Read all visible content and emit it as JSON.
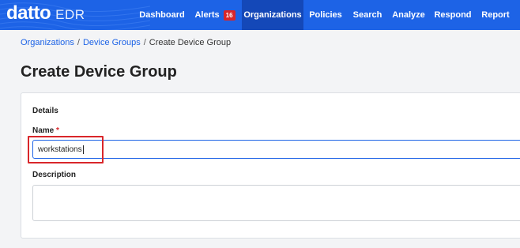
{
  "header": {
    "logo": "datto",
    "product": "EDR",
    "nav": [
      {
        "label": "Dashboard",
        "active": false
      },
      {
        "label": "Alerts",
        "badge": "16",
        "active": false
      },
      {
        "label": "Organizations",
        "active": true
      },
      {
        "label": "Policies",
        "active": false
      },
      {
        "label": "Search",
        "active": false
      },
      {
        "label": "Analyze",
        "active": false
      },
      {
        "label": "Respond",
        "active": false
      },
      {
        "label": "Report",
        "active": false
      }
    ],
    "colors": {
      "bar": "#1d63e6",
      "active": "#1448b8",
      "badge": "#d9262a"
    }
  },
  "breadcrumb": {
    "items": [
      "Organizations",
      "Device Groups",
      "Create Device Group"
    ],
    "separator": "/"
  },
  "page": {
    "title": "Create Device Group"
  },
  "form": {
    "section": "Details",
    "name": {
      "label": "Name",
      "required_mark": "*",
      "value": "workstations"
    },
    "description": {
      "label": "Description",
      "value": ""
    }
  },
  "annotation": {
    "highlight_color": "#d9262a"
  }
}
